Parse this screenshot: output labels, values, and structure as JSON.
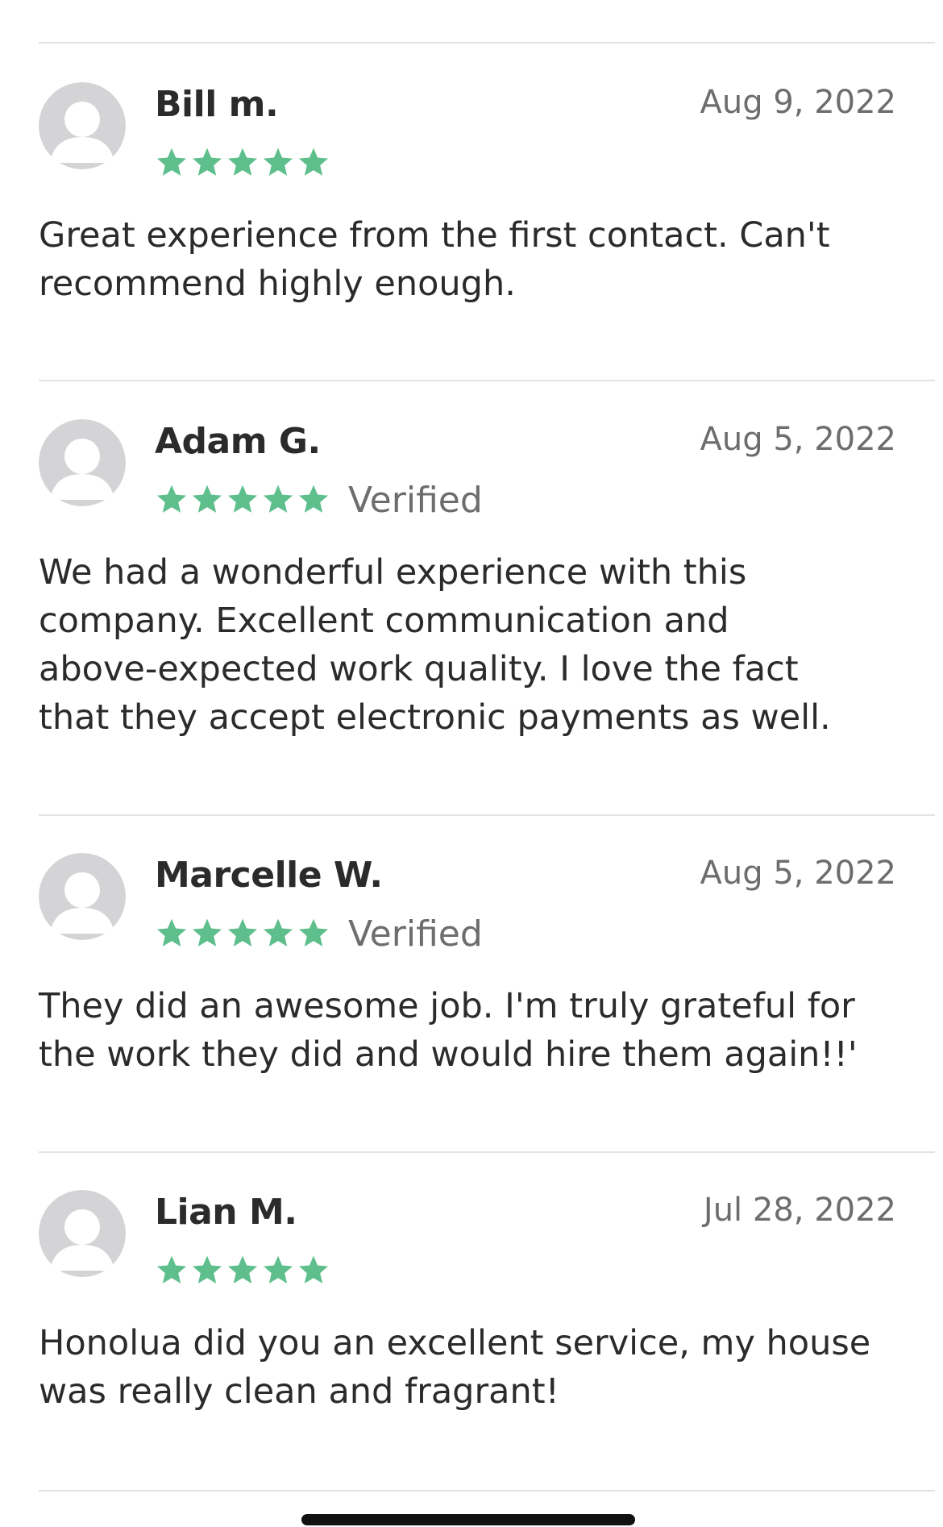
{
  "colors": {
    "star": "#5fbf8c",
    "avatar_bg": "#d4d4d6",
    "avatar_fg": "#ffffff",
    "divider": "#e3e3e3"
  },
  "reviews": [
    {
      "name": "Bill m.",
      "date": "Aug 9, 2022",
      "rating": 5,
      "verified": "",
      "text": "Great experience from the first contact. Can't\nrecommend highly enough."
    },
    {
      "name": "Adam G.",
      "date": "Aug 5, 2022",
      "rating": 5,
      "verified": "Verified",
      "text": "We had a wonderful experience with this\ncompany. Excellent communication and\nabove-expected work quality.  I love the fact\nthat they accept electronic payments as well."
    },
    {
      "name": "Marcelle W.",
      "date": "Aug 5, 2022",
      "rating": 5,
      "verified": "Verified",
      "text": "They did an awesome job. I'm truly grateful for\nthe work they did and would hire them again!!'"
    },
    {
      "name": "Lian M.",
      "date": "Jul 28, 2022",
      "rating": 5,
      "verified": "",
      "text": "Honolua did you an excellent service, my house\nwas really clean and fragrant!"
    }
  ]
}
